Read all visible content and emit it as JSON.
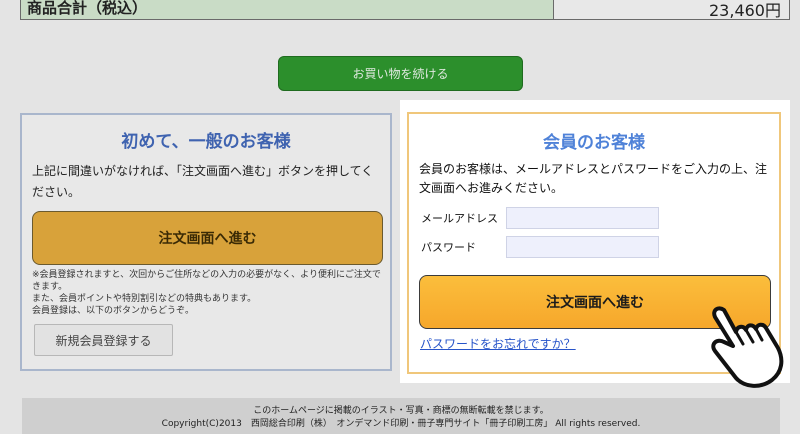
{
  "summary": {
    "total_label": "商品合計（税込）",
    "total_value": "23,460円"
  },
  "continue_button": "お買い物を続ける",
  "guest": {
    "title": "初めて、一般のお客様",
    "description": "上記に間違いがなければ、「注文画面へ進む」ボタンを押してください。",
    "proceed_button": "注文画面へ進む",
    "note_line1": "※会員登録されますと、次回からご住所などの入力の必要がなく、より便利にご注文できます。",
    "note_line2": "また、会員ポイントや特別割引などの特典もあります。",
    "note_line3": "会員登録は、以下のボタンからどうぞ。",
    "register_button": "新規会員登録する"
  },
  "member": {
    "title": "会員のお客様",
    "description": "会員のお客様は、メールアドレスとパスワードをご入力の上、注文画面へお進みください。",
    "email_label": "メールアドレス",
    "email_value": "",
    "password_label": "パスワード",
    "password_value": "",
    "proceed_button": "注文画面へ進む",
    "forgot_link": "パスワードをお忘れですか？"
  },
  "footer": {
    "line1": "このホームページに掲載のイラスト・写真・商標の無断転載を禁じます。",
    "line2": "Copyright(C)2013　西岡総合印刷（株）　オンデマンド印刷・冊子専門サイト「冊子印刷工房」 All rights reserved."
  },
  "colors": {
    "accent_orange": "#f6a72b",
    "title_blue": "#4f82d8",
    "continue_green": "#2c8f2c"
  },
  "icons": {
    "pointer": "hand-pointer-icon"
  }
}
